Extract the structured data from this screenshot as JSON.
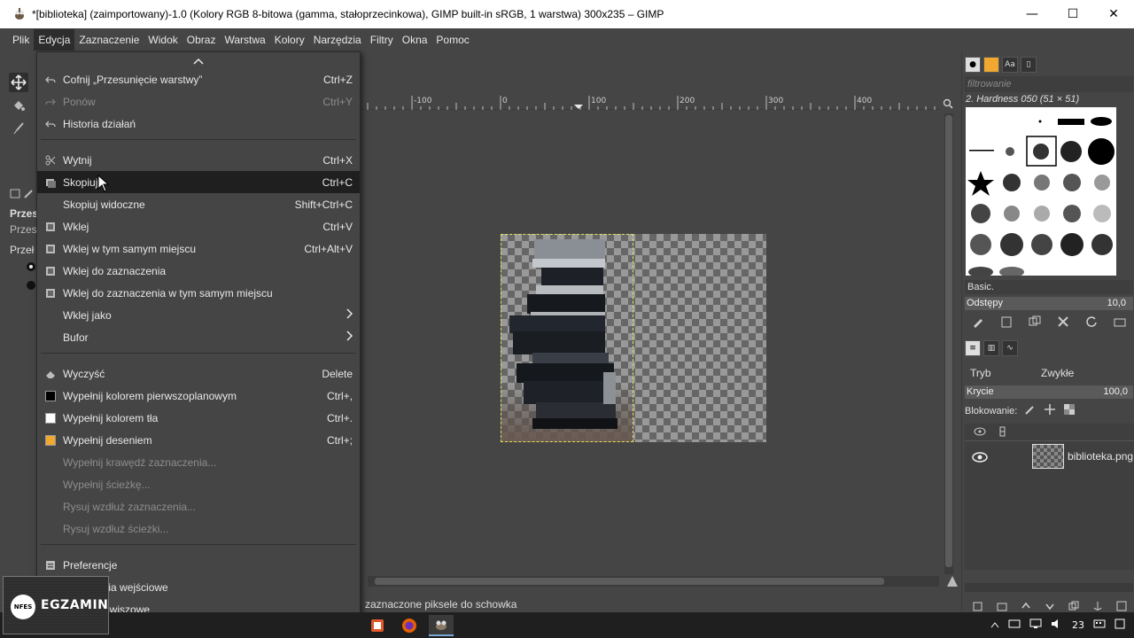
{
  "window": {
    "title": "*[biblioteka] (zaimportowany)-1.0 (Kolory RGB 8-bitowa (gamma, stałoprzecinkowa), GIMP built-in sRGB, 1 warstwa) 300x235 – GIMP",
    "minimize": "—",
    "maximize": "☐",
    "close": "✕"
  },
  "menubar": {
    "items": [
      "Plik",
      "Edycja",
      "Zaznaczenie",
      "Widok",
      "Obraz",
      "Warstwa",
      "Kolory",
      "Narzędzia",
      "Filtry",
      "Okna",
      "Pomoc"
    ],
    "active_index": 1
  },
  "toolbox": {
    "options_label_1": "Przes",
    "options_label_2": "Przes",
    "options_label_3": "Przeł"
  },
  "edit_menu": {
    "items": [
      {
        "label": "Cofnij „Przesunięcie warstwy”",
        "shortcut": "Ctrl+Z",
        "icon": "undo-icon",
        "disabled": false
      },
      {
        "label": "Ponów",
        "shortcut": "Ctrl+Y",
        "icon": "redo-icon",
        "disabled": true
      },
      {
        "label": "Historia działań",
        "shortcut": "",
        "icon": "history-icon",
        "disabled": false
      },
      {
        "label": "Wytnij",
        "shortcut": "Ctrl+X",
        "icon": "scissors-icon",
        "disabled": false
      },
      {
        "label": "Skopiuj",
        "shortcut": "Ctrl+C",
        "icon": "copy-icon",
        "disabled": false
      },
      {
        "label": "Skopiuj widoczne",
        "shortcut": "Shift+Ctrl+C",
        "icon": "",
        "disabled": false
      },
      {
        "label": "Wklej",
        "shortcut": "Ctrl+V",
        "icon": "paste-icon",
        "disabled": false
      },
      {
        "label": "Wklej w tym samym miejscu",
        "shortcut": "Ctrl+Alt+V",
        "icon": "paste-in-place-icon",
        "disabled": false
      },
      {
        "label": "Wklej do zaznaczenia",
        "shortcut": "",
        "icon": "paste-into-icon",
        "disabled": false
      },
      {
        "label": "Wklej do zaznaczenia w tym samym miejscu",
        "shortcut": "",
        "icon": "paste-into-in-place-icon",
        "disabled": false
      },
      {
        "label": "Wklej jako",
        "shortcut": "",
        "icon": "",
        "disabled": false,
        "submenu": true
      },
      {
        "label": "Bufor",
        "shortcut": "",
        "icon": "",
        "disabled": false,
        "submenu": true
      },
      {
        "label": "Wyczyść",
        "shortcut": "Delete",
        "icon": "eraser-icon",
        "disabled": false
      },
      {
        "label": "Wypełnij kolorem pierwszoplanowym",
        "shortcut": "Ctrl+,",
        "icon": "fg-color-icon",
        "disabled": false
      },
      {
        "label": "Wypełnij kolorem tła",
        "shortcut": "Ctrl+.",
        "icon": "bg-color-icon",
        "disabled": false
      },
      {
        "label": "Wypełnij deseniem",
        "shortcut": "Ctrl+;",
        "icon": "pattern-icon",
        "disabled": false
      },
      {
        "label": "Wypełnij krawędź zaznaczenia...",
        "shortcut": "",
        "icon": "",
        "disabled": true
      },
      {
        "label": "Wypełnij ścieżkę...",
        "shortcut": "",
        "icon": "",
        "disabled": true
      },
      {
        "label": "Rysuj wzdłuż zaznaczenia...",
        "shortcut": "",
        "icon": "",
        "disabled": true
      },
      {
        "label": "Rysuj wzdłuż ścieżki...",
        "shortcut": "",
        "icon": "",
        "disabled": true
      },
      {
        "label": "Preferencje",
        "shortcut": "",
        "icon": "preferences-icon",
        "disabled": false
      },
      {
        "label": "Urządzenia wejściowe",
        "shortcut": "",
        "icon": "",
        "disabled": false
      },
      {
        "label": "Skróty klawiszowe",
        "shortcut": "",
        "icon": "",
        "disabled": false
      }
    ],
    "highlighted_index": 4,
    "colors": {
      "fg": "#000000",
      "bg": "#ffffff",
      "pattern": "#f0a830"
    }
  },
  "ruler": {
    "labels": [
      "-100",
      "0",
      "100",
      "200",
      "300",
      "400"
    ]
  },
  "statusbar": {
    "message": "zaznaczone piksele do schowka"
  },
  "dock": {
    "filter_placeholder": "filtrowanie",
    "brush_name": "2. Hardness 050 (51 × 51)",
    "brush_preset": "Basic.",
    "spacing_label": "Odstępy",
    "spacing_value": "10,0",
    "mode_label": "Tryb",
    "mode_value": "Zwykłe",
    "opacity_label": "Krycie",
    "opacity_value": "100,0",
    "lock_label": "Blokowanie:",
    "layer_name": "biblioteka.png"
  },
  "taskbar": {
    "clock": "23"
  },
  "watermark": {
    "badge": "NFES",
    "word": "EGZAMIN"
  }
}
